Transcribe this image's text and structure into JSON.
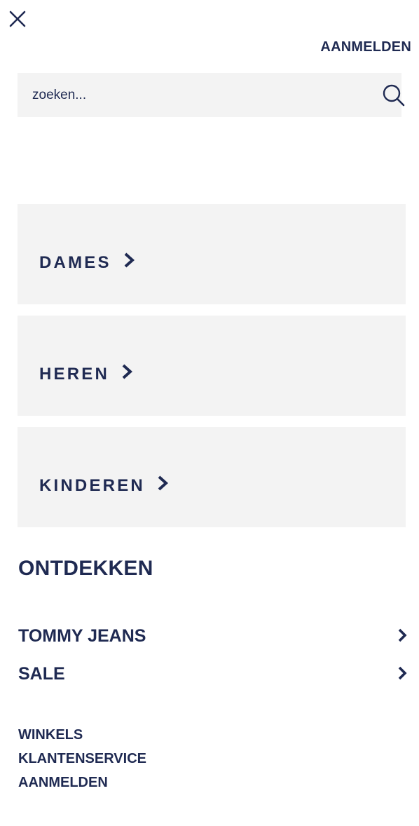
{
  "header": {
    "close_icon": "close-icon",
    "login_label": "AANMELDEN"
  },
  "search": {
    "placeholder": "zoeken...",
    "value": "",
    "icon": "search-icon"
  },
  "categories": [
    {
      "label": "DAMES",
      "icon": "chevron-right-icon"
    },
    {
      "label": "HEREN",
      "icon": "chevron-right-icon"
    },
    {
      "label": "KINDEREN",
      "icon": "chevron-right-icon"
    }
  ],
  "discover": {
    "title": "ONTDEKKEN",
    "items": [
      {
        "label": "TOMMY JEANS",
        "icon": "chevron-right-icon"
      },
      {
        "label": "SALE",
        "icon": "chevron-right-icon"
      }
    ]
  },
  "footer_links": [
    "WINKELS",
    "KLANTENSERVICE",
    "AANMELDEN"
  ],
  "colors": {
    "text": "#1f2a52",
    "panel_bg": "#f3f3f3",
    "background": "#ffffff"
  }
}
